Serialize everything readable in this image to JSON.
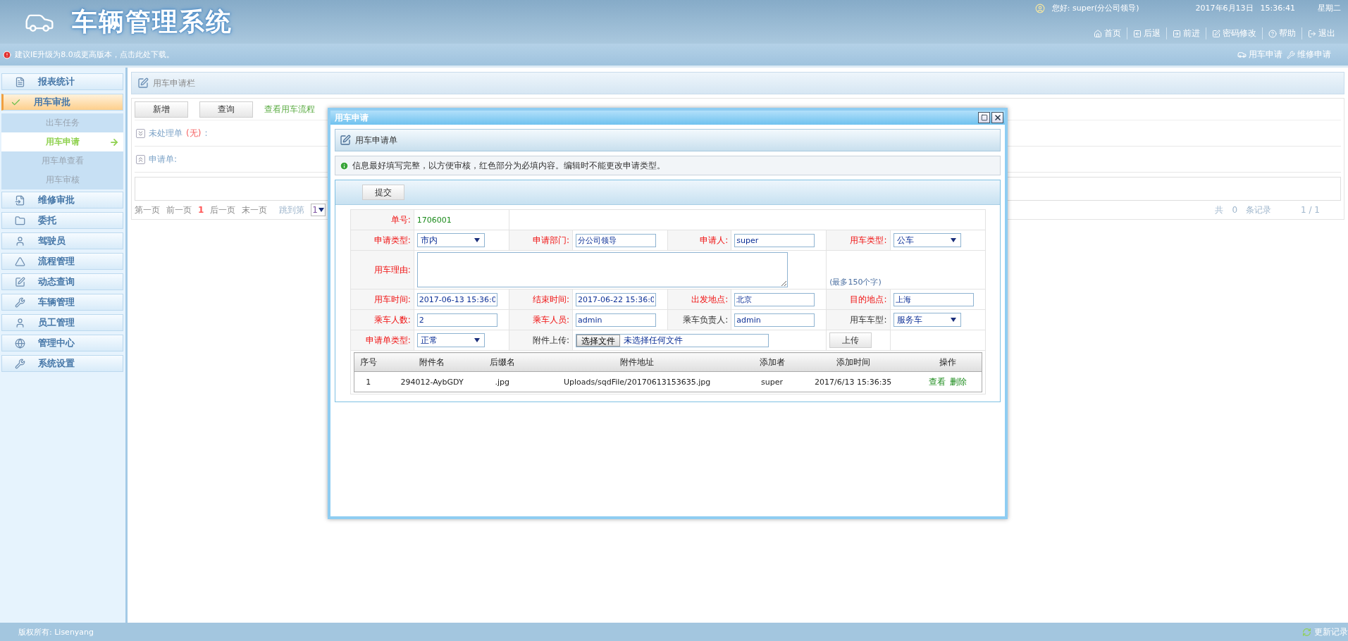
{
  "header": {
    "title": "车辆管理系统",
    "greeting": "您好: super(分公司领导)",
    "date": "2017年6月13日",
    "time": "15:36:41",
    "weekday": "星期二",
    "nav": [
      "首页",
      "后退",
      "前进",
      "密码修改",
      "帮助",
      "退出"
    ]
  },
  "notice_bar": {
    "message": "建议IE升级为8.0或更高版本，点击此处下载。",
    "shortcuts": [
      "用车申请",
      "维修申请"
    ]
  },
  "sidebar": {
    "items": [
      {
        "label": "报表统计",
        "selected": false
      },
      {
        "label": "用车审批",
        "selected": true,
        "children": [
          {
            "label": "出车任务",
            "selected": false
          },
          {
            "label": "用车申请",
            "selected": true
          },
          {
            "label": "用车单查看",
            "selected": false
          },
          {
            "label": "用车审核",
            "selected": false
          }
        ]
      },
      {
        "label": "维修审批",
        "selected": false
      },
      {
        "label": "委托",
        "selected": false
      },
      {
        "label": "驾驶员",
        "selected": false
      },
      {
        "label": "流程管理",
        "selected": false
      },
      {
        "label": "动态查询",
        "selected": false
      },
      {
        "label": "车辆管理",
        "selected": false
      },
      {
        "label": "员工管理",
        "selected": false
      },
      {
        "label": "管理中心",
        "selected": false
      },
      {
        "label": "系统设置",
        "selected": false
      }
    ]
  },
  "panel": {
    "title": "用车申请栏",
    "buttons": [
      "新增",
      "查询"
    ],
    "flow_link": "查看用车流程",
    "sections": [
      {
        "label": "未处理单",
        "status": "(无)",
        "tail": ":",
        "expanded": false
      },
      {
        "label": "申请单:",
        "expanded": true
      }
    ],
    "pagination": {
      "first": "第一页",
      "prev": "前一页",
      "current": "1",
      "next": "后一页",
      "last": "末一页",
      "jump_label": "跳到第",
      "jump_value": "1",
      "total_prefix": "共",
      "total": "0",
      "total_suffix": "条记录",
      "page": "1 / 1"
    }
  },
  "dialog": {
    "title": "用车申请",
    "form_title": "用车申请单",
    "info": "信息最好填写完整，以方便审核，红色部分为必填内容。编辑时不能更改申请类型。",
    "submit": "提交",
    "rows": [
      [
        {
          "kind": "label",
          "text": "单号:",
          "required": true
        },
        {
          "kind": "text",
          "value": "1706001"
        },
        {
          "kind": "blank",
          "colspan": 6
        }
      ],
      [
        {
          "kind": "label",
          "text": "申请类型:",
          "required": true
        },
        {
          "kind": "select",
          "value": "市内"
        },
        {
          "kind": "label",
          "text": "申请部门:",
          "required": true
        },
        {
          "kind": "input",
          "value": "分公司领导"
        },
        {
          "kind": "label",
          "text": "申请人:",
          "required": true
        },
        {
          "kind": "input",
          "value": "super"
        },
        {
          "kind": "label",
          "text": "用车类型:",
          "required": true
        },
        {
          "kind": "select",
          "value": "公车"
        }
      ],
      [
        {
          "kind": "label",
          "text": "用车理由:",
          "required": true
        },
        {
          "kind": "textarea",
          "colspan": 5
        },
        {
          "kind": "hint",
          "text": "(最多150个字)",
          "colspan": 2
        }
      ],
      [
        {
          "kind": "label",
          "text": "用车时间:",
          "required": true
        },
        {
          "kind": "input",
          "value": "2017-06-13 15:36:0"
        },
        {
          "kind": "label",
          "text": "结束时间:",
          "required": true
        },
        {
          "kind": "input",
          "value": "2017-06-22 15:36:0"
        },
        {
          "kind": "label",
          "text": "出发地点:",
          "required": true
        },
        {
          "kind": "input",
          "value": "北京"
        },
        {
          "kind": "label",
          "text": "目的地点:",
          "required": true
        },
        {
          "kind": "input",
          "value": "上海"
        }
      ],
      [
        {
          "kind": "label",
          "text": "乘车人数:",
          "required": true
        },
        {
          "kind": "input",
          "value": "2"
        },
        {
          "kind": "label",
          "text": "乘车人员:",
          "required": true
        },
        {
          "kind": "input",
          "value": "admin"
        },
        {
          "kind": "label",
          "text": "乘车负责人:",
          "required": false
        },
        {
          "kind": "input",
          "value": "admin"
        },
        {
          "kind": "label",
          "text": "用车车型:",
          "required": false
        },
        {
          "kind": "select",
          "value": "服务车"
        }
      ],
      [
        {
          "kind": "label",
          "text": "申请单类型:",
          "required": true
        },
        {
          "kind": "select",
          "value": "正常"
        },
        {
          "kind": "label",
          "text": "附件上传:",
          "required": false
        },
        {
          "kind": "file",
          "button": "选择文件",
          "status": "未选择任何文件",
          "colspan": 3
        },
        {
          "kind": "button",
          "label": "上传"
        },
        {
          "kind": "blank"
        }
      ]
    ],
    "attachments": {
      "columns": [
        "序号",
        "附件名",
        "后缀名",
        "附件地址",
        "添加者",
        "添加时间",
        "操作"
      ],
      "rows": [
        {
          "cells": [
            "1",
            "294012-AybGDY",
            ".jpg",
            "Uploads/sqdFile/20170613153635.jpg",
            "super",
            "2017/6/13 15:36:35"
          ],
          "actions": [
            "查看",
            "删除"
          ]
        }
      ]
    }
  },
  "footer": {
    "copyright": "版权所有: Lisenyang",
    "update_link": "更新记录"
  }
}
